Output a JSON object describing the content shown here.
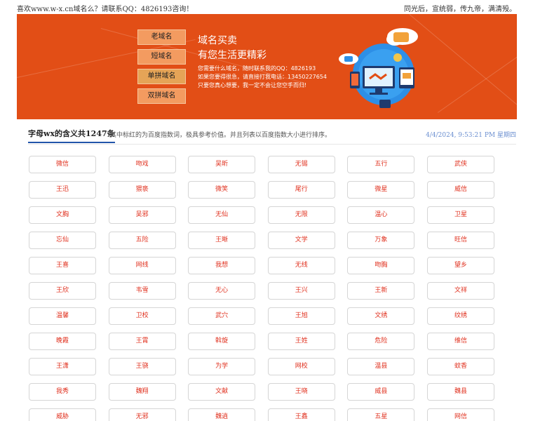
{
  "topbar": {
    "left_text": "喜欢www.w-x.cn域名么？请联系QQ：4826193咨询！",
    "right_text": "同光后，宣统弱，传九帝，满清殁。"
  },
  "banner": {
    "menu": [
      {
        "label": "老域名",
        "active": false
      },
      {
        "label": "短域名",
        "active": false
      },
      {
        "label": "单拼域名",
        "active": true
      },
      {
        "label": "双拼域名",
        "active": false
      }
    ],
    "slogan_line1": "域名买卖",
    "slogan_line2": "有您生活更精彩",
    "info_lines": [
      "您需要什么域名，随时联系我的QQ：4826193",
      "如果您要得很急，请直接打我电话：13450227654",
      "只要您真心想要，我一定不会让您空手而归!"
    ]
  },
  "section": {
    "title": "字母wx的含义共1247条",
    "description": "其中标红的为百度指数词，极具参考价值。并且列表以百度指数大小进行排序。",
    "date": "4/4/2024, 9:53:21 PM 星期四"
  },
  "words": [
    [
      "微信",
      "吻戏",
      "吴昕",
      "无锡",
      "五行",
      "武侠"
    ],
    [
      "王迅",
      "猥亵",
      "微笑",
      "尾行",
      "微星",
      "威信"
    ],
    [
      "文胸",
      "吴邪",
      "无仙",
      "无限",
      "温心",
      "卫星"
    ],
    [
      "忘仙",
      "五险",
      "王晰",
      "文学",
      "万象",
      "旺信"
    ],
    [
      "王喜",
      "网线",
      "我想",
      "无线",
      "吻胸",
      "望乡"
    ],
    [
      "王欣",
      "韦雪",
      "无心",
      "王兴",
      "王新",
      "文祥"
    ],
    [
      "温馨",
      "卫校",
      "武穴",
      "王旭",
      "文绣",
      "纹绣"
    ],
    [
      "晚霞",
      "王霄",
      "斡旋",
      "王姓",
      "危险",
      "维信"
    ],
    [
      "王潇",
      "王骁",
      "为学",
      "网校",
      "温县",
      "蚊香"
    ],
    [
      "我秀",
      "魏翔",
      "文献",
      "王晓",
      "威县",
      "魏县"
    ],
    [
      "威胁",
      "无邪",
      "魏逍",
      "王鑫",
      "五星",
      "网信"
    ]
  ]
}
